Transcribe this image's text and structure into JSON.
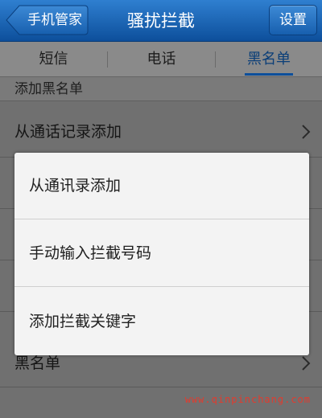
{
  "header": {
    "back_label": "手机管家",
    "title": "骚扰拦截",
    "settings_label": "设置"
  },
  "tabs": [
    {
      "label": "短信"
    },
    {
      "label": "电话"
    },
    {
      "label": "黑名单",
      "active": true
    }
  ],
  "list": {
    "section_title": "添加黑名单",
    "items": [
      {
        "label": "从通话记录添加"
      },
      {
        "label": ""
      },
      {
        "label": ""
      },
      {
        "label": ""
      },
      {
        "label": ""
      },
      {
        "label": "黑名单"
      }
    ]
  },
  "popup": {
    "items": [
      {
        "label": "从通讯录添加"
      },
      {
        "label": "手动输入拦截号码"
      },
      {
        "label": "添加拦截关键字"
      }
    ]
  },
  "watermark": "www.qinpinchang.com",
  "colors": {
    "header_blue": "#1a66b8",
    "active_tab": "#0a3e78",
    "watermark_red": "#e23b2e"
  },
  "icons": {
    "back": "back-arrow-icon",
    "chevron": "chevron-right-icon"
  }
}
